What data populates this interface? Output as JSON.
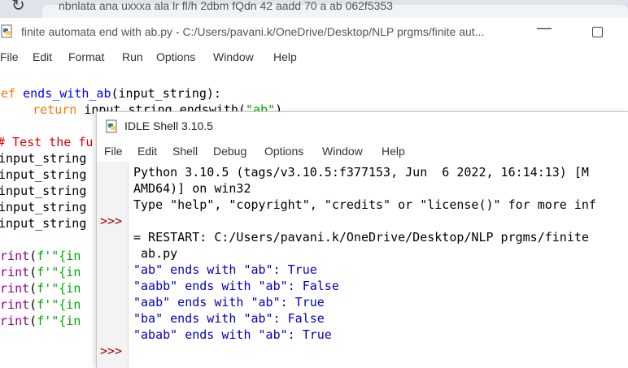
{
  "browser": {
    "tab_text": "nbnlata ana uxxxa ala lr fl/h 2dbm fQdn 42 aadd 70 a ab 062f5353"
  },
  "editor": {
    "title": "finite automata end with ab.py - C:/Users/pavani.k/OneDrive/Desktop/NLP prgms/finite aut...",
    "menu": [
      "File",
      "Edit",
      "Format",
      "Run",
      "Options",
      "Window",
      "Help"
    ],
    "code": {
      "l1_kw": "def",
      "l1_fn": "ends_with_ab",
      "l1_rest": "(input_string):",
      "l2_indent": "    ",
      "l2_kw": "return",
      "l2_mid": " input_string.endswith(",
      "l2_str": "\"ab\"",
      "l2_end": ")",
      "l4_comment": "# Test the fu",
      "assign_lines": [
        "input_string",
        "input_string",
        "input_string",
        "input_string",
        "input_string"
      ],
      "print_kw": "print",
      "print_rest_a": "(",
      "print_rest_b": "f'\"{in"
    }
  },
  "shell": {
    "title": "IDLE Shell 3.10.5",
    "menu": [
      "File",
      "Edit",
      "Shell",
      "Debug",
      "Options",
      "Window",
      "Help"
    ],
    "prompt": ">>>",
    "banner_1": "Python 3.10.5 (tags/v3.10.5:f377153, Jun  6 2022, 16:14:13) [M",
    "banner_2": "AMD64)] on win32",
    "banner_3": "Type \"help\", \"copyright\", \"credits\" or \"license()\" for more inf",
    "restart_1": "= RESTART: C:/Users/pavani.k/OneDrive/Desktop/NLP prgms/finite",
    "restart_2": " ab.py",
    "outputs": [
      "\"ab\" ends with \"ab\": True",
      "\"aabb\" ends with \"ab\": False",
      "\"aab\" ends with \"ab\": True",
      "\"ba\" ends with \"ab\": False",
      "\"abab\" ends with \"ab\": True"
    ]
  },
  "colors": {
    "keyword": "#ff7700",
    "function_name": "#0000ff",
    "string": "#00aa00",
    "comment": "#dd0000",
    "builtin": "#900090",
    "output": "#0000c0",
    "prompt": "#a00000"
  }
}
